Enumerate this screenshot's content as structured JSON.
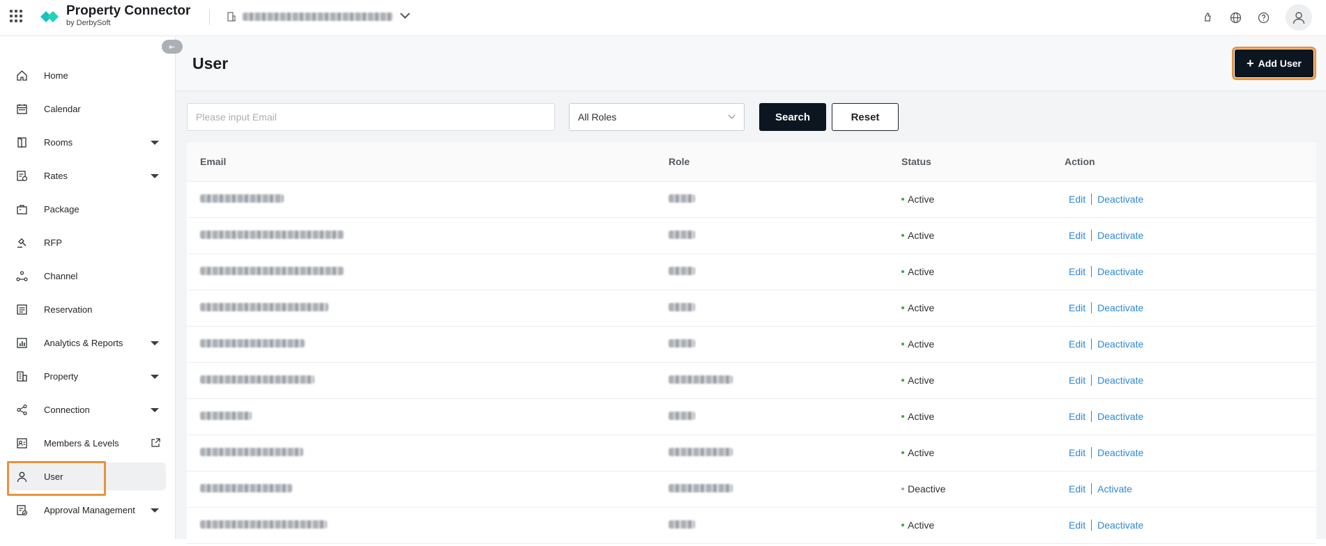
{
  "app": {
    "brand_title": "Property Connector",
    "brand_subtitle": "by DerbySoft",
    "brand_color": "#19c2c2"
  },
  "topbar": {
    "apps_icon": "apps-grid-icon",
    "property_icon": "building-icon",
    "icons": [
      "notification-icon",
      "globe-icon",
      "help-icon",
      "user-avatar-icon"
    ]
  },
  "sidebar": {
    "items": [
      {
        "label": "Home",
        "icon": "home-icon",
        "has_caret": false
      },
      {
        "label": "Calendar",
        "icon": "calendar-icon",
        "has_caret": false
      },
      {
        "label": "Rooms",
        "icon": "door-icon",
        "has_caret": true
      },
      {
        "label": "Rates",
        "icon": "rates-icon",
        "has_caret": true
      },
      {
        "label": "Package",
        "icon": "package-icon",
        "has_caret": false
      },
      {
        "label": "RFP",
        "icon": "gavel-icon",
        "has_caret": false
      },
      {
        "label": "Channel",
        "icon": "channel-icon",
        "has_caret": false
      },
      {
        "label": "Reservation",
        "icon": "reservation-icon",
        "has_caret": false
      },
      {
        "label": "Analytics & Reports",
        "icon": "analytics-icon",
        "has_caret": true
      },
      {
        "label": "Property",
        "icon": "building-icon",
        "has_caret": true
      },
      {
        "label": "Connection",
        "icon": "share-icon",
        "has_caret": true
      },
      {
        "label": "Members & Levels",
        "icon": "members-icon",
        "has_caret": false
      },
      {
        "label": "User",
        "icon": "user-icon",
        "has_caret": false
      },
      {
        "label": "Approval Management",
        "icon": "approval-icon",
        "has_caret": true
      }
    ]
  },
  "page": {
    "title": "User",
    "add_button_label": "Add User"
  },
  "filters": {
    "email_placeholder": "Please input Email",
    "role_selected": "All Roles",
    "search_label": "Search",
    "reset_label": "Reset"
  },
  "table": {
    "headers": {
      "email": "Email",
      "role": "Role",
      "status": "Status",
      "action": "Action"
    },
    "rows": [
      {
        "status": "Active",
        "action_primary": "Edit",
        "action_secondary": "Deactivate"
      },
      {
        "status": "Active",
        "action_primary": "Edit",
        "action_secondary": "Deactivate"
      },
      {
        "status": "Active",
        "action_primary": "Edit",
        "action_secondary": "Deactivate"
      },
      {
        "status": "Active",
        "action_primary": "Edit",
        "action_secondary": "Deactivate"
      },
      {
        "status": "Active",
        "action_primary": "Edit",
        "action_secondary": "Deactivate"
      },
      {
        "status": "Active",
        "action_primary": "Edit",
        "action_secondary": "Deactivate"
      },
      {
        "status": "Active",
        "action_primary": "Edit",
        "action_secondary": "Deactivate"
      },
      {
        "status": "Active",
        "action_primary": "Edit",
        "action_secondary": "Deactivate"
      },
      {
        "status": "Deactive",
        "action_primary": "Edit",
        "action_secondary": "Activate"
      },
      {
        "status": "Active",
        "action_primary": "Edit",
        "action_secondary": "Deactivate"
      }
    ]
  },
  "colors": {
    "active_dot": "#3aa54a",
    "deactive_dot": "#a0a4a8",
    "link": "#2b88d9",
    "highlight": "#e8923d"
  }
}
